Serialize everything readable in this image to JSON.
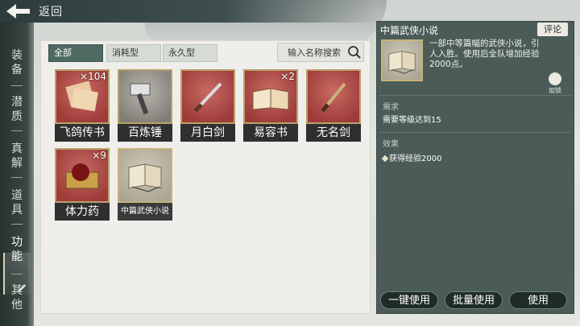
{
  "header": {
    "back_label": "返回"
  },
  "nav": {
    "items": [
      {
        "label_top": "装",
        "label_bottom": "备"
      },
      {
        "label_top": "潜",
        "label_bottom": "质"
      },
      {
        "label_top": "真",
        "label_bottom": "解"
      },
      {
        "label_top": "道",
        "label_bottom": "具"
      },
      {
        "label_top": "功",
        "label_bottom": "能"
      },
      {
        "label_top": "其",
        "label_bottom": "他"
      }
    ],
    "active_index": 4
  },
  "filters": {
    "tabs": [
      "全部",
      "消耗型",
      "永久型"
    ],
    "active": "全部",
    "search_placeholder": "输入名称搜索"
  },
  "items": [
    {
      "name": "飞鸽传书",
      "count": "×104",
      "rarity": "red",
      "icon": "letter-icon"
    },
    {
      "name": "百炼锤",
      "count": "",
      "rarity": "grey",
      "icon": "hammer-icon"
    },
    {
      "name": "月白剑",
      "count": "",
      "rarity": "red",
      "icon": "sword-icon"
    },
    {
      "name": "易容书",
      "count": "×2",
      "rarity": "red",
      "icon": "book-icon"
    },
    {
      "name": "无名剑",
      "count": "",
      "rarity": "red",
      "icon": "sword-icon"
    },
    {
      "name": "体力药",
      "count": "×9",
      "rarity": "red",
      "icon": "potion-box-icon"
    },
    {
      "name": "中篇武侠小说",
      "count": "",
      "rarity": "selected",
      "icon": "novel-icon"
    }
  ],
  "detail": {
    "title": "中篇武侠小说",
    "comment_label": "评论",
    "description": "一部中等篇幅的武侠小说，引人入胜。使用后全队增加经验2000点。",
    "lock_label": "加锁",
    "requirement_label": "需求",
    "requirement_text": "需要等级达到15",
    "effect_label": "效果",
    "effect_text": "获得经验2000"
  },
  "actions": {
    "use_all_label": "一键使用",
    "batch_use_label": "批量使用",
    "use_label": "使用"
  },
  "colors": {
    "accent": "#4e6a63",
    "rarity_red": "#9e3c39",
    "rarity_grey": "#7f7d76",
    "frame_gold": "#b9a06a",
    "detail_bg": "#4a5b58"
  }
}
